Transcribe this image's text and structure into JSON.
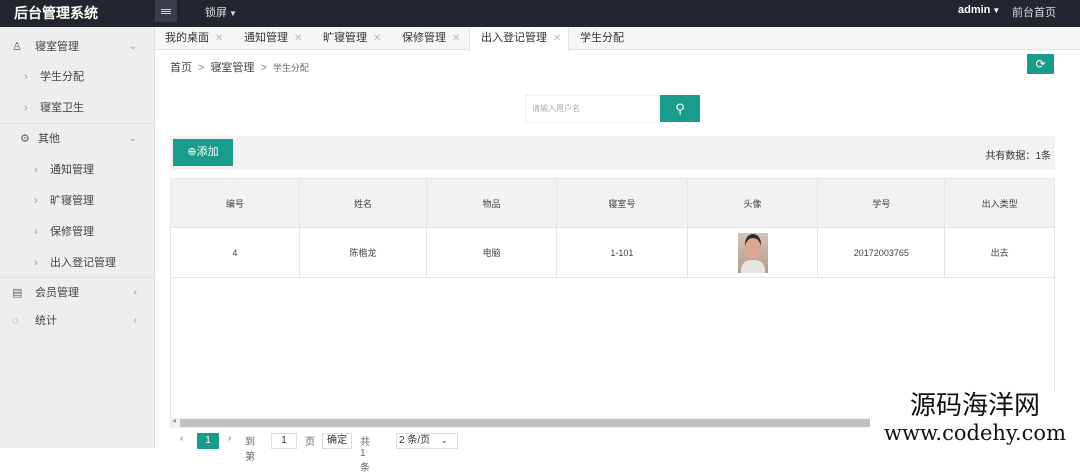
{
  "app": {
    "title": "后台管理系统",
    "lock_label": "锁屏",
    "user": "admin",
    "front_link": "前台首页"
  },
  "sidebar": {
    "groups": [
      {
        "label": "寝室管理",
        "icon": "user-icon",
        "items": [
          "学生分配",
          "寝室卫生"
        ]
      },
      {
        "label": "其他",
        "icon": "settings-icon",
        "items": [
          "通知管理",
          "旷寝管理",
          "保修管理",
          "出入登记管理"
        ]
      },
      {
        "label": "会员管理",
        "icon": "member-icon"
      },
      {
        "label": "统计",
        "icon": "chart-icon"
      }
    ]
  },
  "tabs": [
    {
      "label": "我的桌面"
    },
    {
      "label": "通知管理"
    },
    {
      "label": "旷寝管理"
    },
    {
      "label": "保修管理"
    },
    {
      "label": "出入登记管理",
      "active": true
    },
    {
      "label": "学生分配"
    }
  ],
  "breadcrumb": {
    "home": "首页",
    "section": "寝室管理",
    "current": "学生分配"
  },
  "search": {
    "placeholder": "请输入用户名"
  },
  "toolbar": {
    "add_label": "添加",
    "total_label": "共有数据：",
    "total_value": "1",
    "total_unit": "条"
  },
  "table": {
    "columns": [
      "编号",
      "姓名",
      "物品",
      "寝室号",
      "头像",
      "学号",
      "出入类型"
    ],
    "rows": [
      {
        "id": "4",
        "name": "陈楷龙",
        "item": "电脑",
        "room": "1-101",
        "student_no": "20172003765",
        "type": "出去"
      }
    ]
  },
  "pagination": {
    "current_page": "1",
    "goto_label": "到第",
    "goto_value": "1",
    "page_unit": "页",
    "confirm_label": "确定",
    "total_text": "共 1 条",
    "page_size": "2 条/页"
  },
  "watermark": {
    "line1": "源码海洋网",
    "line2": "www.codehy.com"
  },
  "colors": {
    "accent": "#1a9c8c",
    "topbar": "#23262e"
  }
}
